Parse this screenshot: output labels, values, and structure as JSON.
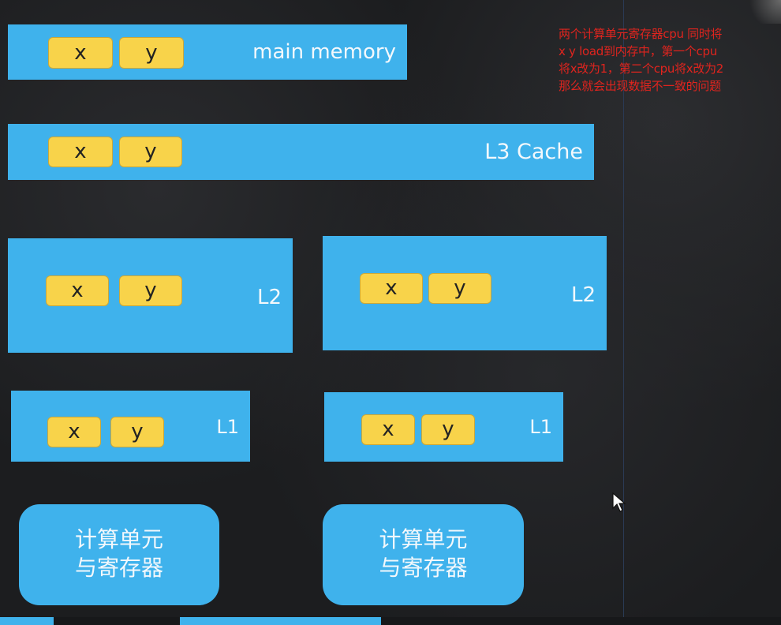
{
  "diagram": {
    "main_memory": {
      "label": "main memory",
      "vars": [
        "x",
        "y"
      ]
    },
    "l3_cache": {
      "label": "L3 Cache",
      "vars": [
        "x",
        "y"
      ]
    },
    "l2_left": {
      "label": "L2",
      "vars": [
        "x",
        "y"
      ]
    },
    "l2_right": {
      "label": "L2",
      "vars": [
        "x",
        "y"
      ]
    },
    "l1_left": {
      "label": "L1",
      "vars": [
        "x",
        "y"
      ]
    },
    "l1_right": {
      "label": "L1",
      "vars": [
        "x",
        "y"
      ]
    },
    "compute_left": {
      "line1": "计算单元",
      "line2": "与寄存器"
    },
    "compute_right": {
      "line1": "计算单元",
      "line2": "与寄存器"
    }
  },
  "annotation": {
    "lines": [
      "两个计算单元寄存器cpu 同时将",
      "x y load到内存中，第一个cpu",
      "将x改为1，第二个cpu将x改为2",
      "那么就会出现数据不一致的问题"
    ],
    "color": "#e0241e"
  },
  "colors": {
    "block": "#3fb2ec",
    "chip": "#f8d34a",
    "background": "#1c1d1f"
  }
}
